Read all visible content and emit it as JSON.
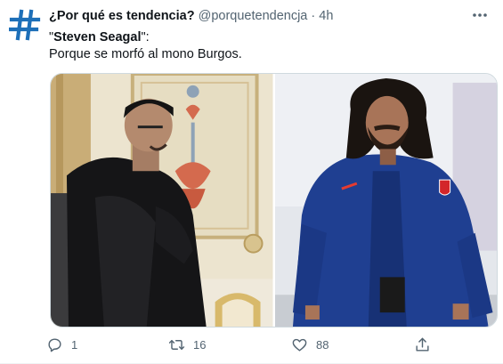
{
  "tweet": {
    "author_name": "¿Por qué es tendencia?",
    "author_handle": "@porquetendencja",
    "separator": "·",
    "time": "4h",
    "text_quote_open": "\"",
    "text_bold": "Steven Seagal",
    "text_quote_close": "\":",
    "text_line2": "Porque se morfó al mono Burgos.",
    "avatar_glyph": "#",
    "avatar_color": "#1d6fb8",
    "icons": {
      "avatar": "hashtag-icon",
      "more": "more-options-icon",
      "reply": "reply-icon",
      "retweet": "retweet-icon",
      "like": "like-icon",
      "share": "share-icon"
    },
    "stats": {
      "replies": "1",
      "retweets": "16",
      "likes": "88"
    },
    "colors": {
      "text": "#0f1419",
      "secondary": "#536471",
      "border": "#cfd9de"
    }
  }
}
